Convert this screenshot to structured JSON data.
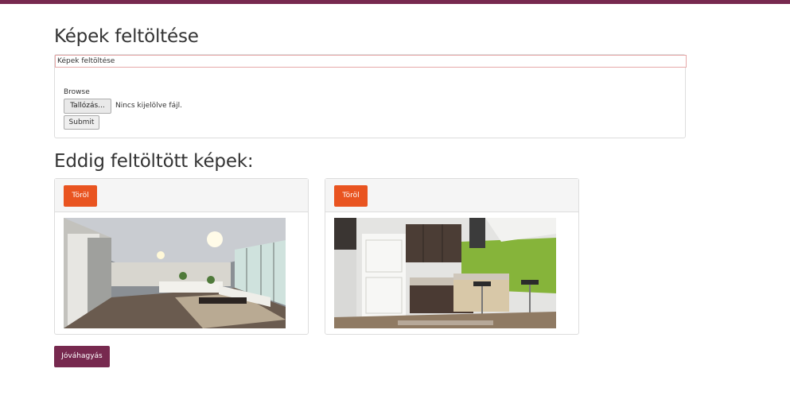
{
  "colors": {
    "topbar": "#77294f",
    "delete_button": "#e95420",
    "approve_button": "#77294f"
  },
  "upload": {
    "heading": "Képek feltöltése",
    "title_input_value": "Képek feltöltése",
    "browse_label": "Browse",
    "file_button_label": "Tallózás...",
    "file_status": "Nincs kijelölve fájl.",
    "submit_label": "Submit"
  },
  "uploaded": {
    "heading": "Eddig feltöltött képek:",
    "images": [
      {
        "delete_label": "Töröl",
        "thumb_icon": "living-room-photo"
      },
      {
        "delete_label": "Töröl",
        "thumb_icon": "kitchen-photo"
      }
    ]
  },
  "approve_label": "Jóváhagyás"
}
